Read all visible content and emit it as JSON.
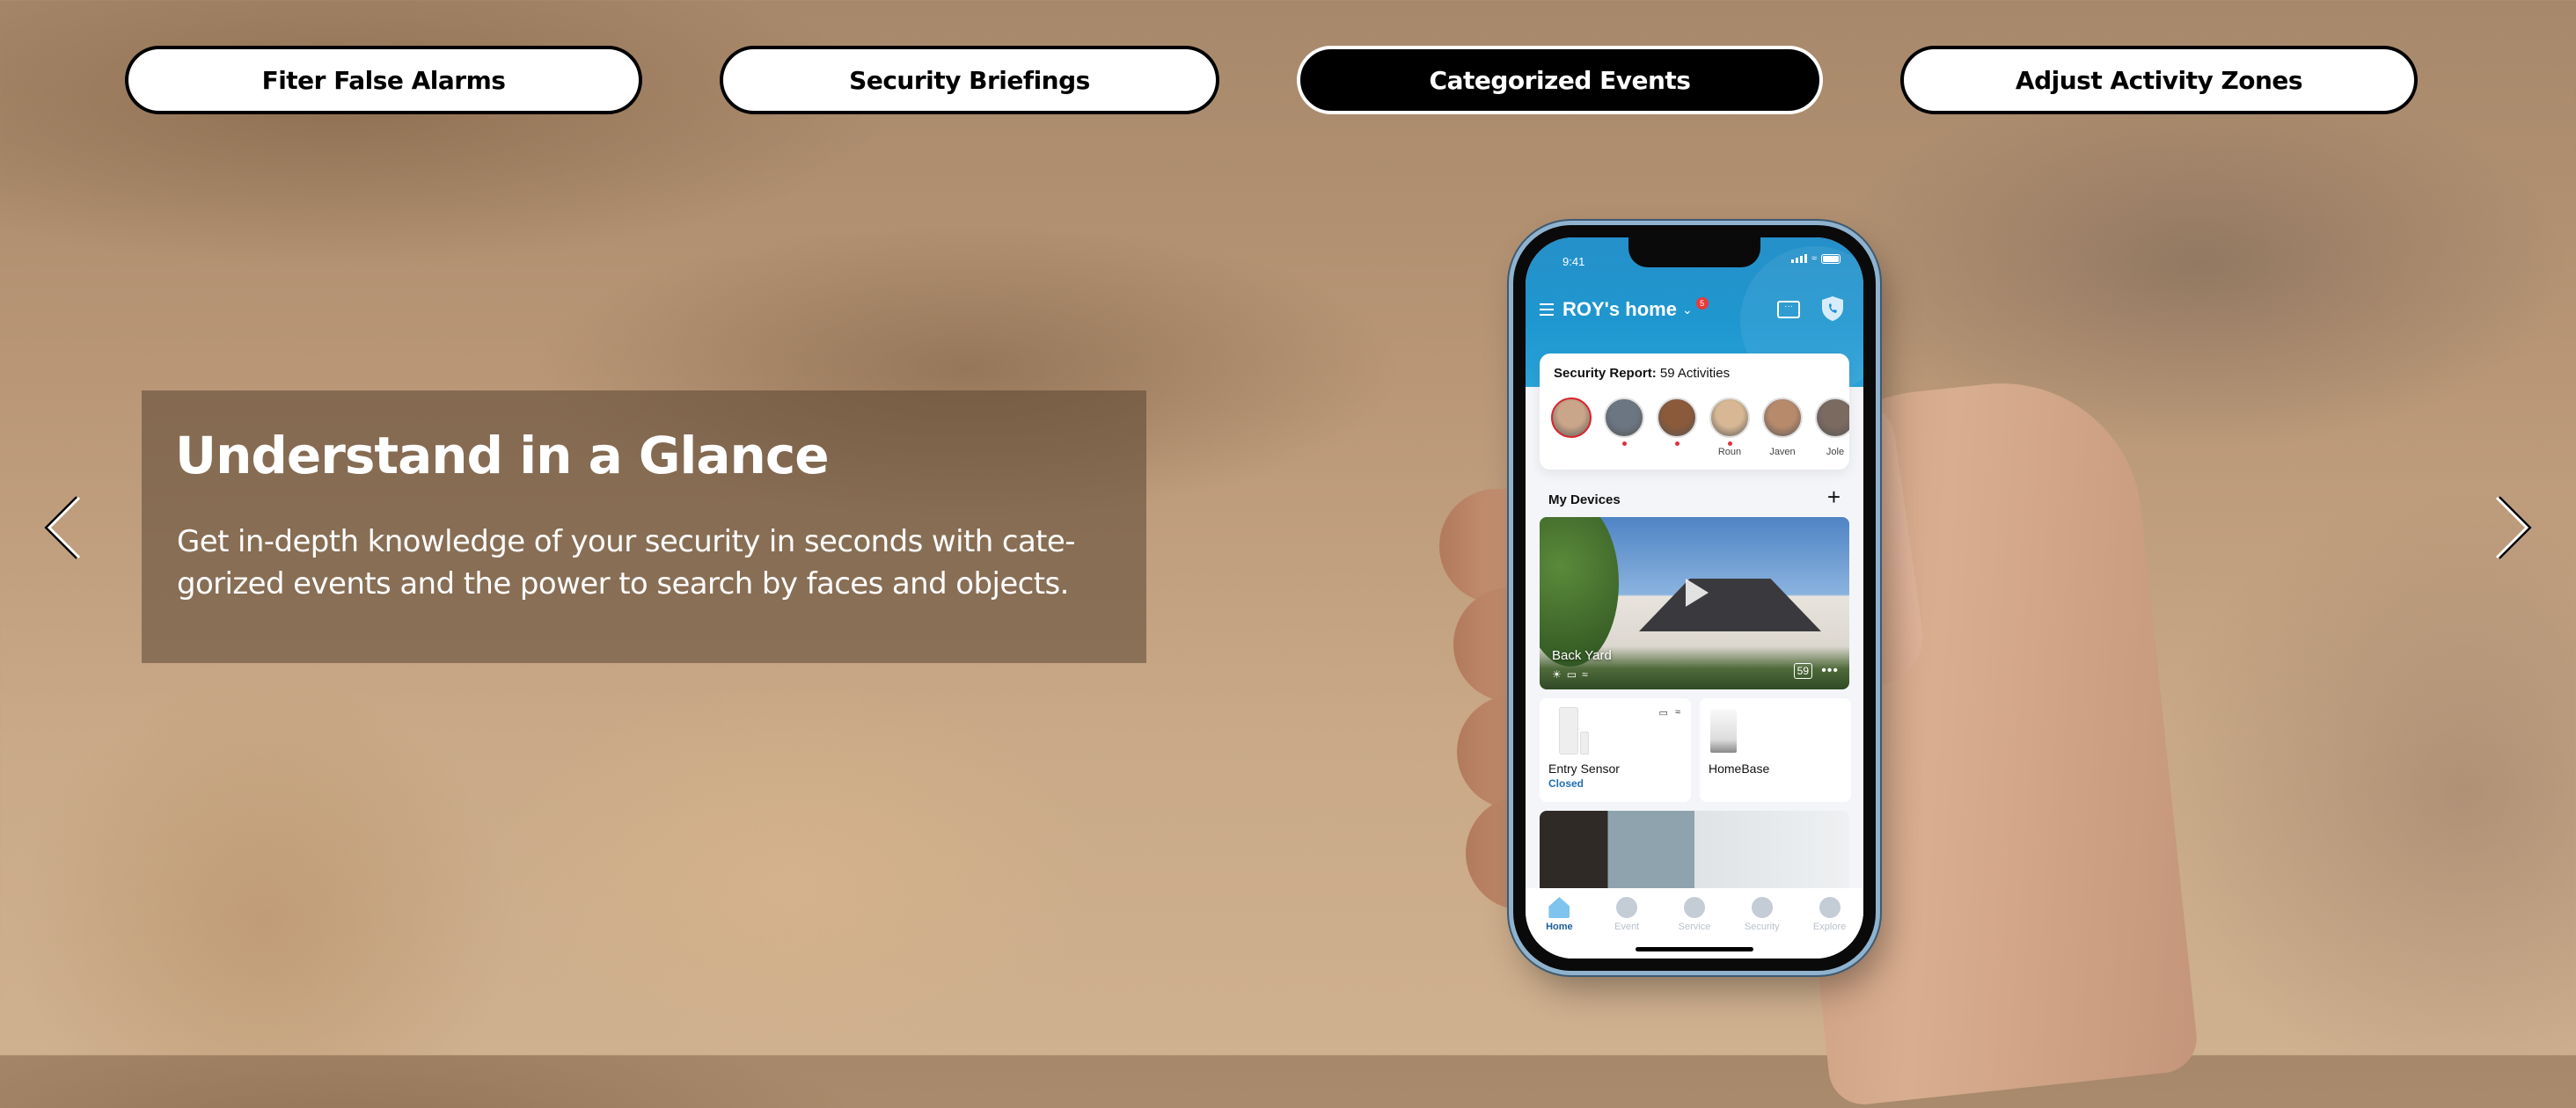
{
  "tabs": [
    {
      "label": "Fiter False Alarms",
      "active": false
    },
    {
      "label": "Security Briefings",
      "active": false
    },
    {
      "label": "Categorized Events",
      "active": true
    },
    {
      "label": "Adjust Activity Zones",
      "active": false
    }
  ],
  "caption": {
    "title": "Understand in a Glance",
    "body": "Get in-depth knowledge of your security in seconds with cate-gorized events and the power to search by faces and objects."
  },
  "nav": {
    "prev_icon": "chevron-left-icon",
    "next_icon": "chevron-right-icon"
  },
  "phone": {
    "status_time": "9:41",
    "home_name": "ROY's home",
    "notification_count": "5",
    "report": {
      "label": "Security Report:",
      "value": "59 Activities",
      "faces": [
        {
          "name": "",
          "dot": false,
          "selected": true,
          "color": "#c9a58a"
        },
        {
          "name": "",
          "dot": true,
          "selected": false,
          "color": "#6c7683"
        },
        {
          "name": "",
          "dot": true,
          "selected": false,
          "color": "#8a5a3a"
        },
        {
          "name": "Roun",
          "dot": true,
          "selected": false,
          "color": "#d8b894"
        },
        {
          "name": "Javen",
          "dot": false,
          "selected": false,
          "color": "#b88a6c"
        },
        {
          "name": "Jole",
          "dot": false,
          "selected": false,
          "color": "#7a6a60"
        }
      ]
    },
    "devices_title": "My Devices",
    "camera": {
      "name": "Back Yard",
      "event_count": "59",
      "more": "•••"
    },
    "tiles": [
      {
        "name": "Entry Sensor",
        "state": "Closed"
      },
      {
        "name": "HomeBase",
        "state": ""
      }
    ],
    "tabbar": [
      {
        "label": "Home",
        "icon": "home-icon",
        "active": true
      },
      {
        "label": "Event",
        "icon": "clock-icon",
        "active": false
      },
      {
        "label": "Service",
        "icon": "diamond-icon",
        "active": false
      },
      {
        "label": "Security",
        "icon": "shield-icon",
        "active": false
      },
      {
        "label": "Explore",
        "icon": "compass-icon",
        "active": false
      }
    ]
  }
}
